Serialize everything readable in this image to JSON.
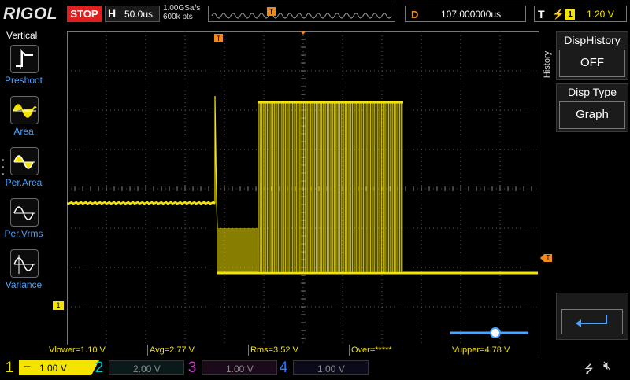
{
  "header": {
    "brand": "RIGOL",
    "run_state": "STOP",
    "horizontal": {
      "label": "H",
      "value": "50.0us"
    },
    "sample_rate": "1.00GSa/s",
    "memory_depth": "600k pts",
    "delay": {
      "label": "D",
      "value": "107.000000us"
    },
    "trigger": {
      "label": "T",
      "source": "1",
      "level": "1.20 V"
    }
  },
  "left_menu": {
    "title": "Vertical",
    "items": [
      {
        "label": "Preshoot",
        "icon": "preshoot-icon"
      },
      {
        "label": "Area",
        "icon": "area-icon"
      },
      {
        "label": "Per.Area",
        "icon": "per-area-icon"
      },
      {
        "label": "Per.Vrms",
        "icon": "per-vrms-icon"
      },
      {
        "label": "Variance",
        "icon": "variance-icon"
      }
    ]
  },
  "right_panel": {
    "tab": "History",
    "disp_history": {
      "title": "DispHistory",
      "value": "OFF"
    },
    "disp_type": {
      "title": "Disp Type",
      "value": "Graph"
    },
    "return_icon": "return-icon"
  },
  "measurements": [
    {
      "label": "Vlower=1.10 V"
    },
    {
      "label": "Avg=2.77 V"
    },
    {
      "label": "Rms=3.52 V"
    },
    {
      "label": "Over=*****"
    },
    {
      "label": "Vupper=4.78 V"
    }
  ],
  "channels": [
    {
      "num": "1",
      "scale": "1.00 V",
      "color": "#f5e400",
      "active": true
    },
    {
      "num": "2",
      "scale": "2.00 V",
      "color": "#00c8c8",
      "active": false
    },
    {
      "num": "3",
      "scale": "1.00 V",
      "color": "#d040d0",
      "active": false
    },
    {
      "num": "4",
      "scale": "1.00 V",
      "color": "#2a7bff",
      "active": false
    }
  ],
  "markers": {
    "ch1_ground_marker": "1",
    "trigger_time_marker": "T",
    "trigger_level_marker": "T"
  },
  "colors": {
    "ch1": "#f5e400",
    "trigger": "#f08a1c",
    "stop": "#e02020",
    "grid": "#5a5a5a"
  }
}
